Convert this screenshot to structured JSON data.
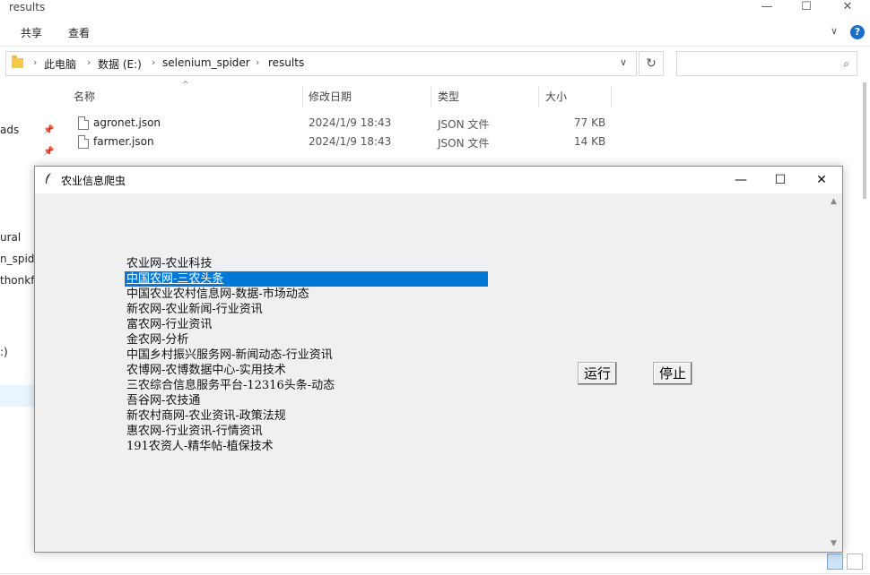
{
  "explorer": {
    "title": "results",
    "window_controls": {
      "minimize": "—",
      "maximize": "☐",
      "close": "✕"
    },
    "ribbon_tabs": [
      "共享",
      "查看"
    ],
    "ribbon_chevron": "∨",
    "help": "?",
    "breadcrumb": [
      "此电脑",
      "数据 (E:)",
      "selenium_spider",
      "results"
    ],
    "breadcrumb_separator": "›",
    "address_dropdown": "∨",
    "refresh": "↻",
    "search_placeholder": "",
    "search_icon": "⌕",
    "columns": [
      "名称",
      "修改日期",
      "类型",
      "大小"
    ],
    "sort_arrow": "^",
    "files": [
      {
        "name": "agronet.json",
        "date": "2024/1/9 18:43",
        "type": "JSON 文件",
        "size": "77 KB"
      },
      {
        "name": "farmer.json",
        "date": "2024/1/9 18:43",
        "type": "JSON 文件",
        "size": "14 KB"
      }
    ],
    "nav_items": [
      "ads",
      "ural",
      "n_spide",
      "thonkfs",
      ":)"
    ]
  },
  "tk_window": {
    "title": "农业信息爬虫",
    "controls": {
      "minimize": "—",
      "maximize": "☐",
      "close": "✕"
    },
    "list_items": [
      "农业网-农业科技",
      "中国农网-三农头条",
      "中国农业农村信息网-数据-市场动态",
      "新农网-农业新闻-行业资讯",
      "富农网-行业资讯",
      "金农网-分析",
      "中国乡村振兴服务网-新闻动态-行业资讯",
      "农博网-农博数据中心-实用技术",
      "三农综合信息服务平台-12316头条-动态",
      "吾谷网-农技通",
      "新农村商网-农业资讯-政策法规",
      "惠农网-行业资讯-行情资讯",
      "191农资人-精华帖-植保技术"
    ],
    "selected_index": 1,
    "run_label": "运行",
    "stop_label": "停止",
    "selection_color": "#0078d7"
  }
}
